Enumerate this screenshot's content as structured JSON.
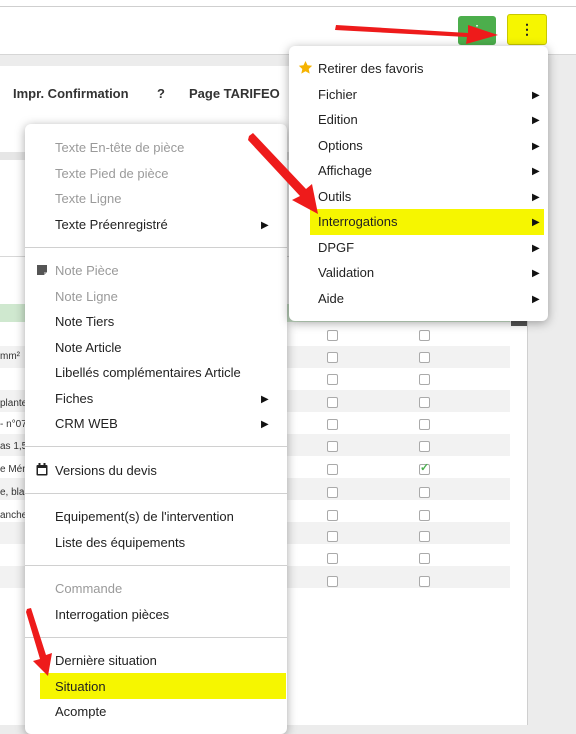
{
  "toolbar": {
    "green_button_glyph": "⋮",
    "kebab_glyph": "⋮",
    "impr_confirmation": "Impr. Confirmation",
    "help": "?",
    "page_tarifeo": "Page TARIFEO"
  },
  "table": {
    "row_snippets": [
      "mm²",
      "plante",
      "- n°07",
      "as 1,5",
      "e Mén",
      "e, bla",
      "anche"
    ]
  },
  "left_menu": {
    "texte_entete": "Texte En-tête de pièce",
    "texte_pied": "Texte Pied de pièce",
    "texte_ligne": "Texte Ligne",
    "texte_preenregistre": "Texte Préenregistré",
    "note_piece": "Note Pièce",
    "note_ligne": "Note Ligne",
    "note_tiers": "Note Tiers",
    "note_article": "Note Article",
    "libelles": "Libellés complémentaires Article",
    "fiches": "Fiches",
    "crm_web": "CRM WEB",
    "versions_devis": "Versions du devis",
    "equipements_intervention": "Equipement(s) de l'intervention",
    "liste_equipements": "Liste des équipements",
    "commande": "Commande",
    "interrogation_pieces": "Interrogation pièces",
    "derniere_situation": "Dernière situation",
    "situation": "Situation",
    "acompte": "Acompte"
  },
  "right_menu": {
    "retirer_favoris": "Retirer des favoris",
    "fichier": "Fichier",
    "edition": "Edition",
    "options": "Options",
    "affichage": "Affichage",
    "outils": "Outils",
    "interrogations": "Interrogations",
    "dpgf": "DPGF",
    "validation": "Validation",
    "aide": "Aide"
  },
  "colors": {
    "highlight": "#f6f600",
    "arrow": "#ee1b1b",
    "green_button": "#4cae4c",
    "star": "#f5b301"
  },
  "icons": [
    "star-icon",
    "note-icon",
    "calendar-icon",
    "chevron-right-icon",
    "kebab-icon",
    "checkmark-icon"
  ]
}
